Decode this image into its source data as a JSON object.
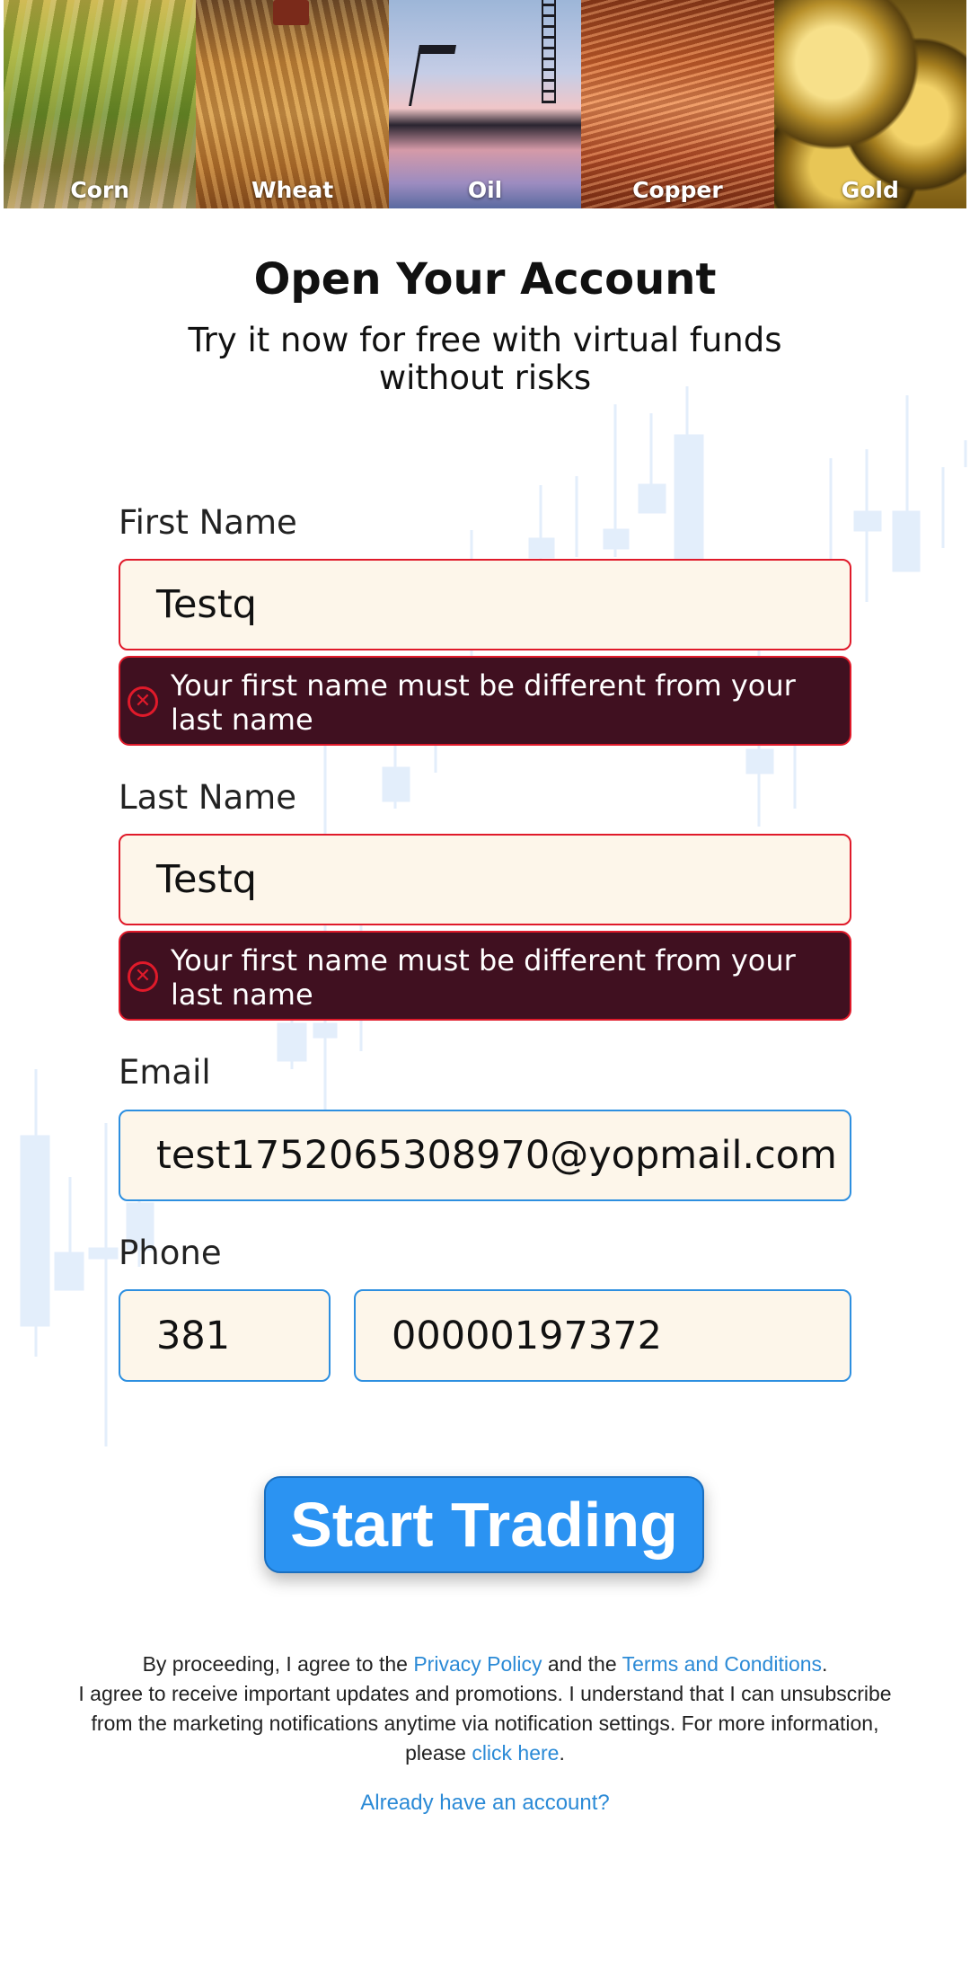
{
  "commodities": [
    {
      "label": "Corn"
    },
    {
      "label": "Wheat"
    },
    {
      "label": "Oil"
    },
    {
      "label": "Copper"
    },
    {
      "label": "Gold"
    }
  ],
  "header": {
    "title": "Open Your Account",
    "subtitle": "Try it now for free with virtual funds without risks"
  },
  "form": {
    "first_name": {
      "label": "First Name",
      "value": "Testq",
      "error": "Your first name must be different from your last name"
    },
    "last_name": {
      "label": "Last Name",
      "value": "Testq",
      "error": "Your first name must be different from your last name"
    },
    "email": {
      "label": "Email",
      "value": "test1752065308970@yopmail.com"
    },
    "phone": {
      "label": "Phone",
      "country_code": "381",
      "number": "00000197372"
    }
  },
  "cta": {
    "label": "Start Trading"
  },
  "legal": {
    "text_1": "By proceeding, I agree to the ",
    "privacy_link": "Privacy Policy",
    "text_2": " and the ",
    "terms_link": "Terms and Conditions",
    "text_3": ".",
    "text_4": "I agree to receive important updates and promotions. I understand that I can unsubscribe from the marketing notifications anytime via notification settings. For more information, please ",
    "click_here_link": "click here",
    "text_5": "."
  },
  "login_link": "Already have an account?",
  "colors": {
    "accent": "#2b93f2",
    "error_bg": "#401020",
    "error_border": "#e01a2a",
    "input_bg": "#fdf6ea",
    "link": "#2b8ad6"
  }
}
